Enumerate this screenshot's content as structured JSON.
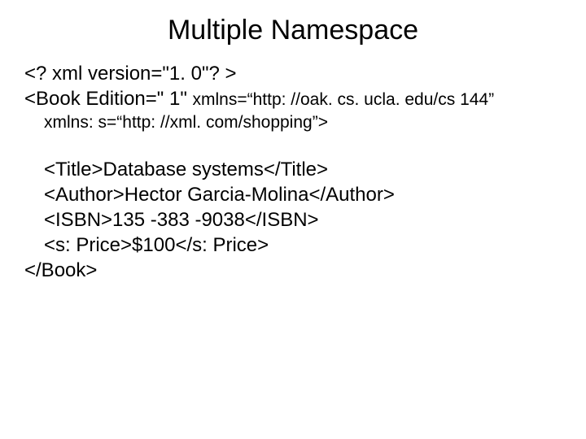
{
  "title": "Multiple Namespace",
  "code": {
    "l1": "<? xml version=\"1. 0\"? >",
    "l2a": "<Book Edition=\" 1\" ",
    "l2b": "xmlns=“http: //oak. cs. ucla. edu/cs 144”",
    "l3": "xmlns: s=“http: //xml. com/shopping”>",
    "l4": "<Title>Database systems</Title>",
    "l5": "<Author>Hector Garcia-Molina</Author>",
    "l6": "<ISBN>135 -383 -9038</ISBN>",
    "l7": "<s: Price>$100</s: Price>",
    "l8": "</Book>"
  }
}
